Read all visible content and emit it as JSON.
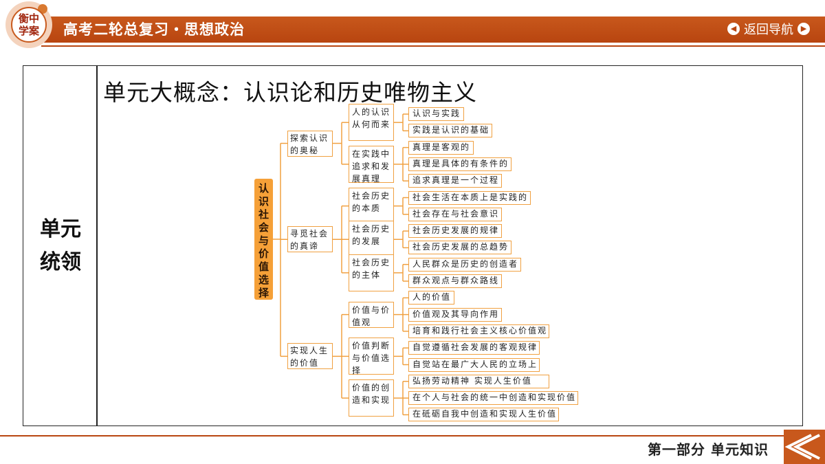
{
  "header": {
    "title": "高考二轮总复习・思想政治",
    "nav_label": "返回导航",
    "logo_line1": "衡中",
    "logo_line2": "学案"
  },
  "side_label_line1": "单元",
  "side_label_line2": "统领",
  "main_title": "单元大概念：认识论和历史唯物主义",
  "mindmap": {
    "root": [
      "认",
      "识",
      "社",
      "会",
      "与",
      "价",
      "值",
      "选",
      "择"
    ],
    "branches": [
      {
        "label": "探索认识的奥秘",
        "children": [
          {
            "label": "人的认识从何而来",
            "leaves": [
              "认识与实践",
              "实践是认识的基础"
            ]
          },
          {
            "label": "在实践中追求和发展真理",
            "leaves": [
              "真理是客观的",
              "真理是具体的有条件的",
              "追求真理是一个过程"
            ]
          }
        ]
      },
      {
        "label": "寻觅社会的真谛",
        "children": [
          {
            "label": "社会历史的本质",
            "leaves": [
              "社会生活在本质上是实践的",
              "社会存在与社会意识"
            ]
          },
          {
            "label": "社会历史的发展",
            "leaves": [
              "社会历史发展的规律",
              "社会历史发展的总趋势"
            ]
          },
          {
            "label": "社会历史的主体",
            "leaves": [
              "人民群众是历史的创造者",
              "群众观点与群众路线"
            ]
          }
        ]
      },
      {
        "label": "实现人生的价值",
        "children": [
          {
            "label": "价值与价值观",
            "leaves": [
              "人的价值",
              "价值观及其导向作用",
              "培育和践行社会主义核心价值观"
            ]
          },
          {
            "label": "价值判断与价值选择",
            "leaves": [
              "自觉遵循社会发展的客观规律",
              "自觉站在最广大人民的立场上"
            ]
          },
          {
            "label": "价值的创造和实现",
            "leaves": [
              "弘扬劳动精神  实现人生价值",
              "在个人与社会的统一中创造和实现价值",
              "在砥砺自我中创造和实现人生价值"
            ]
          }
        ]
      }
    ]
  },
  "footer": {
    "text": "第一部分  单元知识"
  },
  "colors": {
    "header_bar": "#b84510",
    "node_border": "#f0a040",
    "root_fill": "#f5a038"
  }
}
